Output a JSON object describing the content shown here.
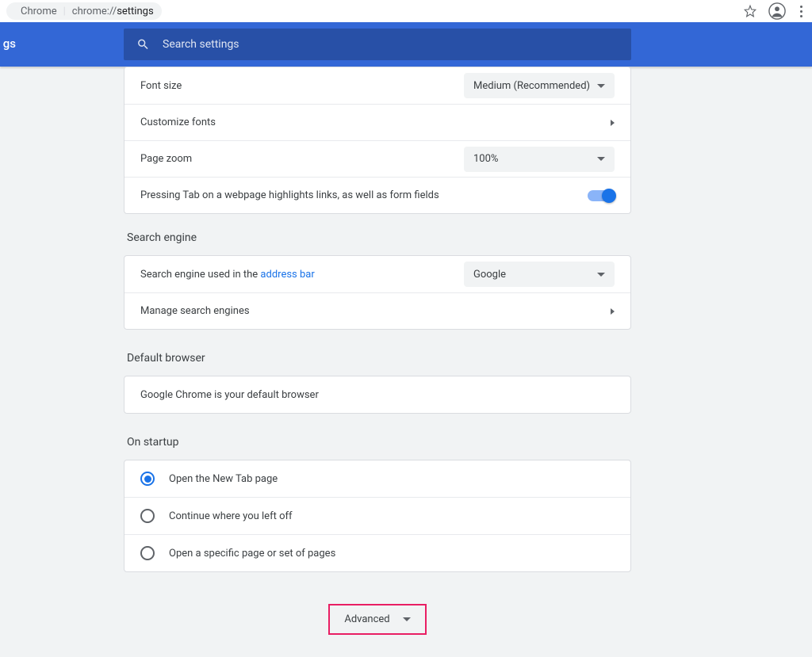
{
  "addressBar": {
    "appName": "Chrome",
    "urlPrefix": "chrome://",
    "urlPath": "settings"
  },
  "header": {
    "sidebarFragment": "gs",
    "searchPlaceholder": "Search settings"
  },
  "appearance": {
    "fontSizeLabel": "Font size",
    "fontSizeValue": "Medium (Recommended)",
    "customizeFonts": "Customize fonts",
    "pageZoomLabel": "Page zoom",
    "pageZoomValue": "100%",
    "tabHighlight": "Pressing Tab on a webpage highlights links, as well as form fields"
  },
  "searchEngine": {
    "title": "Search engine",
    "usedInPrefix": "Search engine used in the ",
    "addressBarLink": "address bar",
    "value": "Google",
    "manage": "Manage search engines"
  },
  "defaultBrowser": {
    "title": "Default browser",
    "message": "Google Chrome is your default browser"
  },
  "startup": {
    "title": "On startup",
    "opt1": "Open the New Tab page",
    "opt2": "Continue where you left off",
    "opt3": "Open a specific page or set of pages"
  },
  "advanced": {
    "label": "Advanced"
  }
}
